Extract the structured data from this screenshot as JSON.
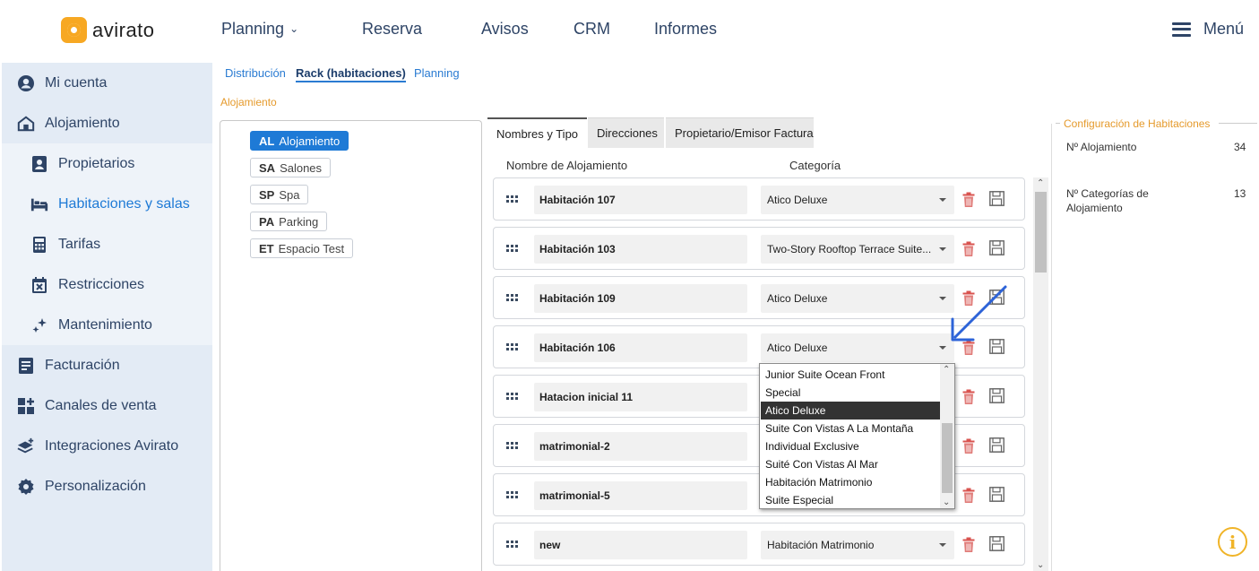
{
  "header": {
    "logo_text": "avirato",
    "nav": [
      {
        "label": "Planning",
        "has_dropdown": true
      },
      {
        "label": "Reserva"
      },
      {
        "label": "Avisos"
      },
      {
        "label": "CRM"
      },
      {
        "label": "Informes"
      }
    ],
    "menu_label": "Menú"
  },
  "sidebar": {
    "items": [
      {
        "label": "Mi cuenta",
        "icon": "user-circle-icon"
      },
      {
        "label": "Alojamiento",
        "icon": "house-icon"
      },
      {
        "label": "Propietarios",
        "icon": "owner-badge-icon"
      },
      {
        "label": "Habitaciones y salas",
        "icon": "bed-icon",
        "active": true
      },
      {
        "label": "Tarifas",
        "icon": "calculator-icon"
      },
      {
        "label": "Restricciones",
        "icon": "calendar-x-icon"
      },
      {
        "label": "Mantenimiento",
        "icon": "sparkle-icon"
      },
      {
        "label": "Facturación",
        "icon": "invoice-icon"
      },
      {
        "label": "Canales de venta",
        "icon": "grid-plus-icon"
      },
      {
        "label": "Integraciones Avirato",
        "icon": "layers-plus-icon"
      },
      {
        "label": "Personalización",
        "icon": "gear-icon"
      }
    ]
  },
  "subtabs": {
    "items": [
      "Distribución",
      "Rack (habitaciones)",
      "Planning"
    ],
    "active": "Rack (habitaciones)"
  },
  "section_label": "Alojamiento",
  "types": [
    {
      "code": "AL",
      "name": "Alojamiento",
      "active": true
    },
    {
      "code": "SA",
      "name": "Salones"
    },
    {
      "code": "SP",
      "name": "Spa"
    },
    {
      "code": "PA",
      "name": "Parking"
    },
    {
      "code": "ET",
      "name": "Espacio Test"
    }
  ],
  "inner_tabs": {
    "items": [
      "Nombres y  Tipo",
      "Direcciones",
      "Propietario/Emisor Factura"
    ],
    "active": "Nombres y  Tipo"
  },
  "columns": {
    "name": "Nombre de  Alojamiento",
    "category": "Categoría"
  },
  "rooms": [
    {
      "name": "Habitación 107",
      "category": "Atico Deluxe"
    },
    {
      "name": "Habitación 103",
      "category": "Two-Story Rooftop Terrace Suite..."
    },
    {
      "name": "Habitación 109",
      "category": "Atico Deluxe"
    },
    {
      "name": "Habitación 106",
      "category": "Atico Deluxe"
    },
    {
      "name": "Hatacion inicial 11",
      "category": ""
    },
    {
      "name": "matrimonial-2",
      "category": ""
    },
    {
      "name": "matrimonial-5",
      "category": ""
    },
    {
      "name": "new",
      "category": "Habitación Matrimonio"
    }
  ],
  "dropdown": {
    "options": [
      "Junior Suite Ocean Front",
      "Special",
      "Atico Deluxe",
      "Suite Con Vistas A La Montaña",
      "Individual Exclusive",
      "Suité Con Vistas Al Mar",
      "Habitación Matrimonio",
      "Suite Especial"
    ],
    "selected": "Atico Deluxe"
  },
  "config": {
    "title": "Configuración de Habitaciones",
    "rows": [
      {
        "label": "Nº Alojamiento",
        "value": "34"
      },
      {
        "label": "Nº Categorías de Alojamiento",
        "value": "13"
      }
    ]
  },
  "colors": {
    "accent": "#1e7ad6",
    "orange": "#e59a2c",
    "sidebar_bg": "#e3ebf5",
    "arrow": "#2d63d8"
  }
}
